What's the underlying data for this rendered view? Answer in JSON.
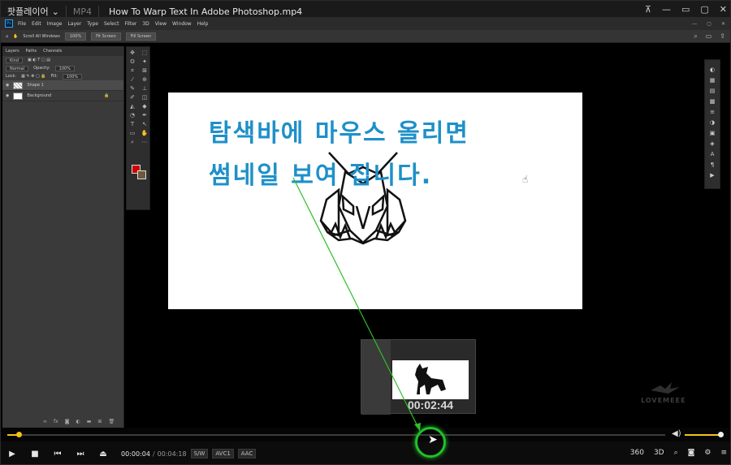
{
  "titlebar": {
    "app_name": "팟플레이어",
    "format": "MP4",
    "file_name": "How To Warp Text In Adobe Photoshop.mp4",
    "buttons": [
      "pin",
      "minimize",
      "restore",
      "maximize",
      "close"
    ]
  },
  "photoshop": {
    "menu": [
      "File",
      "Edit",
      "Image",
      "Layer",
      "Type",
      "Select",
      "Filter",
      "3D",
      "View",
      "Window",
      "Help"
    ],
    "options": {
      "scroll_all": "Scroll All Windows",
      "zoom": "100%",
      "fit": "Fit Screen",
      "fill": "Fill Screen"
    },
    "layers_panel": {
      "tabs": [
        "Layers",
        "Paths",
        "Channels"
      ],
      "kind": "Kind",
      "blend": "Normal",
      "opacity_label": "Opacity:",
      "opacity": "100%",
      "lock_label": "Lock:",
      "fill_label": "Fill:",
      "fill": "100%",
      "layers": [
        {
          "name": "Shape 1",
          "selected": true
        },
        {
          "name": "Background",
          "selected": false
        }
      ]
    },
    "foreground_color": "#cc0000",
    "background_color": "#6d5a3a"
  },
  "annotation": {
    "line1": "탐색바에 마우스 올리면",
    "line2": "썸네일 보여 집니다.",
    "color": "#1e90c8"
  },
  "preview": {
    "time": "00:02:44"
  },
  "watermark": "LOVEMEEE",
  "player": {
    "time_current": "00:00:04",
    "time_separator": "/",
    "time_total": "00:04:18",
    "badges": [
      "S/W",
      "AVC1",
      "AAC"
    ],
    "accent_color": "#f0c419",
    "highlight_color": "#22c02a",
    "progress_fraction": 0.017,
    "volume_fraction": 0.96,
    "right_buttons": [
      "360",
      "3D",
      "zoom-icon",
      "capture-icon",
      "settings-icon",
      "menu-icon"
    ]
  }
}
